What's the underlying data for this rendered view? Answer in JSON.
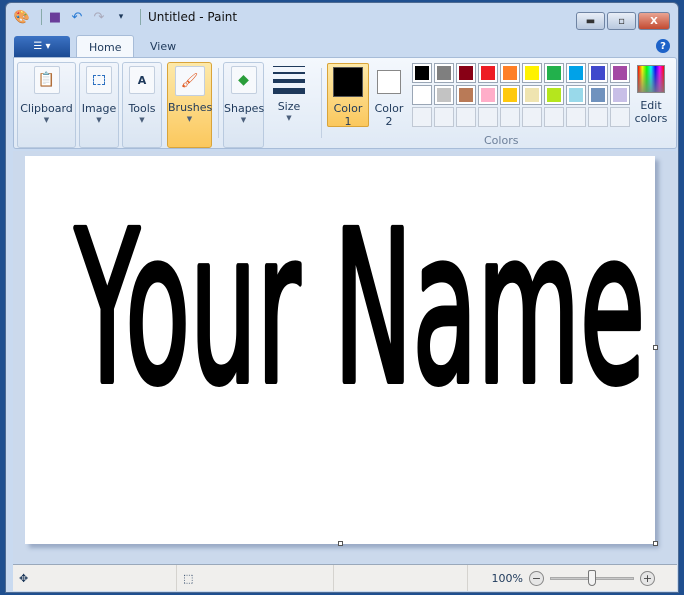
{
  "title": "Untitled - Paint",
  "quick_access": [
    "paint-icon",
    "save-icon",
    "undo-icon",
    "redo-icon",
    "customize-icon"
  ],
  "window_buttons": {
    "minimize": "▭",
    "maximize": "◻",
    "close": "X"
  },
  "tabs": [
    {
      "label": "Home",
      "active": true
    },
    {
      "label": "View",
      "active": false
    }
  ],
  "help": "?",
  "ribbon": {
    "groups": {
      "clipboard": "Clipboard",
      "image": "Image",
      "tools": "Tools",
      "brushes": "Brushes",
      "shapes": "Shapes",
      "size": "Size"
    },
    "color1": {
      "line1": "Color",
      "line2": "1",
      "value": "#000000"
    },
    "color2": {
      "line1": "Color",
      "line2": "2",
      "value": "#ffffff"
    },
    "palette": [
      "#000000",
      "#7f7f7f",
      "#880015",
      "#ed1c24",
      "#ff7f27",
      "#fff200",
      "#22b14c",
      "#00a2e8",
      "#3f48cc",
      "#a349a4",
      "#ffffff",
      "#c3c3c3",
      "#b97a57",
      "#ffaec9",
      "#ffc90e",
      "#efe4b0",
      "#b5e61d",
      "#99d9ea",
      "#7092be",
      "#c8bfe7"
    ],
    "empty_slots": 10,
    "colors_label": "Colors",
    "edit_colors": {
      "line1": "Edit",
      "line2": "colors"
    }
  },
  "canvas": {
    "drawing_text": "Your Name",
    "stroke_color": "#000000"
  },
  "status": {
    "zoom": "100%",
    "zoom_fraction": 0.5
  }
}
